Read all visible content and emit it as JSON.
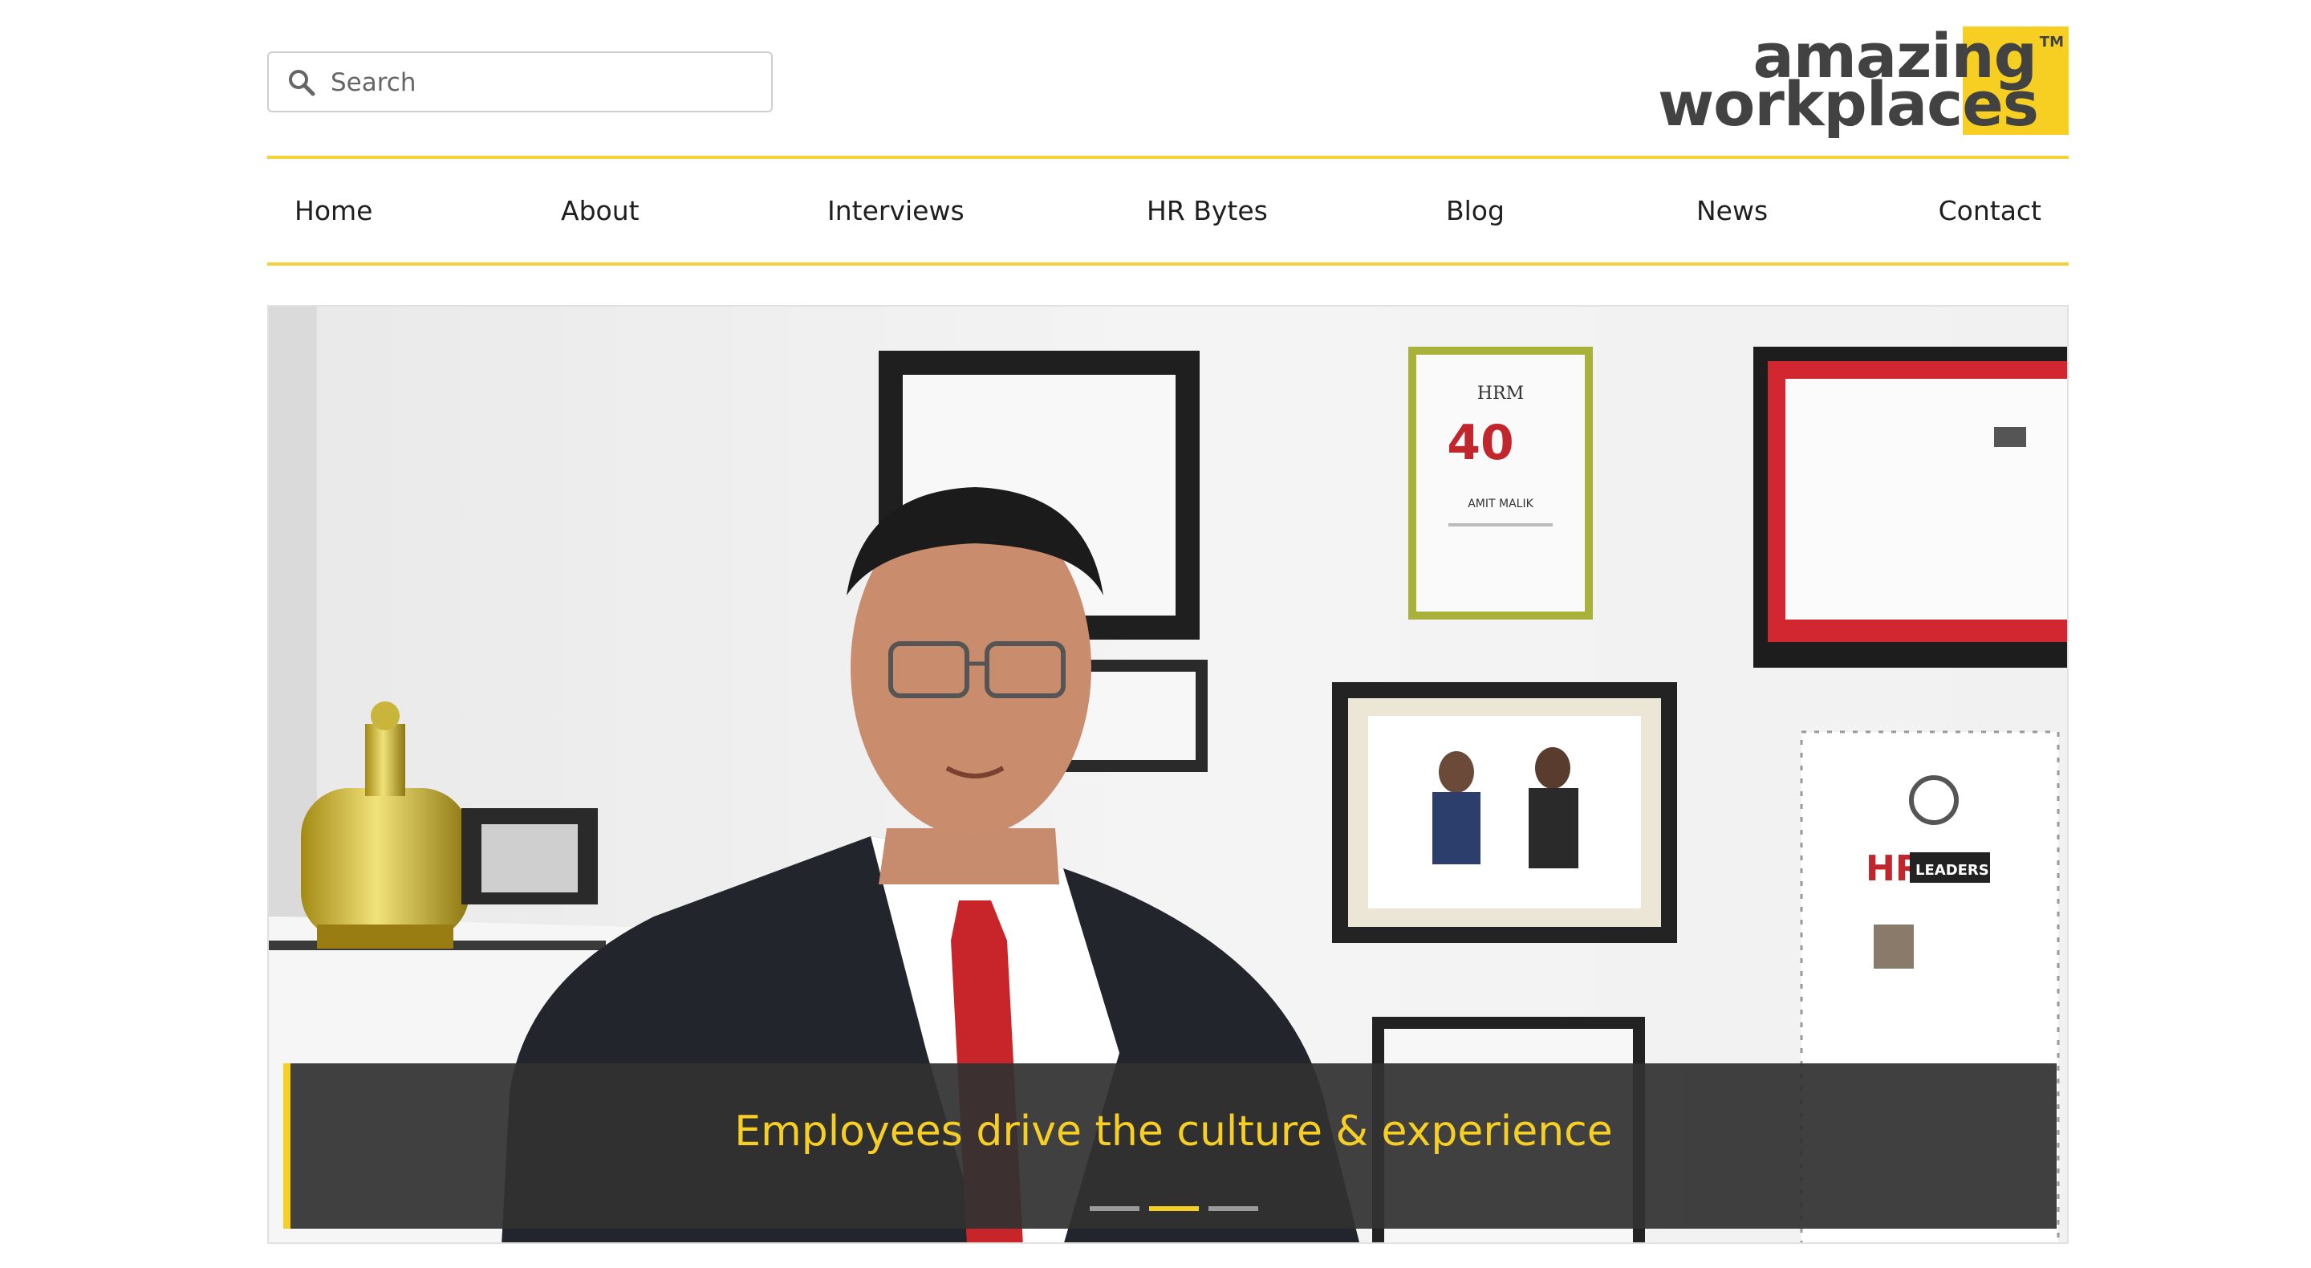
{
  "search": {
    "placeholder": "Search"
  },
  "logo": {
    "line1": "amazing",
    "line2": "workplaces",
    "tm": "TM"
  },
  "nav": [
    {
      "label": "Home"
    },
    {
      "label": "About"
    },
    {
      "label": "Interviews"
    },
    {
      "label": "HR Bytes"
    },
    {
      "label": "Blog"
    },
    {
      "label": "News"
    },
    {
      "label": "Contact"
    }
  ],
  "hero": {
    "caption": "Employees drive the culture & experience",
    "slide_count": 3,
    "active_slide": 2,
    "certificate_text": {
      "hrm": "HRM",
      "number": "40",
      "name": "AMIT MALIK",
      "hr": "HR",
      "leaders": "LEADERS"
    }
  },
  "colors": {
    "accent": "#f7cf23",
    "text": "#1f1f1f",
    "caption_bg": "#323232"
  }
}
